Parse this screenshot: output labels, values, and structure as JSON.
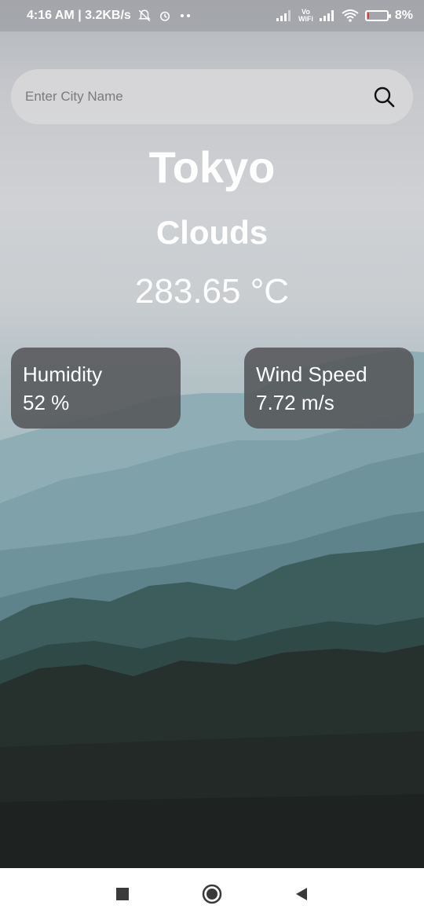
{
  "status_bar": {
    "time_speed": "4:16 AM | 3.2KB/s",
    "vowifi": "Vo\nWiFi",
    "battery_text": "8%",
    "battery_level": 0.08
  },
  "search": {
    "placeholder": "Enter City Name",
    "value": ""
  },
  "weather": {
    "city": "Tokyo",
    "condition": "Clouds",
    "temperature": "283.65 °C"
  },
  "cards": {
    "humidity": {
      "label": "Humidity",
      "value": "52 %"
    },
    "wind": {
      "label": "Wind Speed",
      "value": "7.72 m/s"
    }
  },
  "icons": {
    "search": "search-icon",
    "recent": "square-icon",
    "home": "circle-icon",
    "back": "triangle-back-icon"
  },
  "colors": {
    "card_bg": "#555759",
    "search_bg": "#d7d7d8",
    "battery_low": "#e53935"
  }
}
